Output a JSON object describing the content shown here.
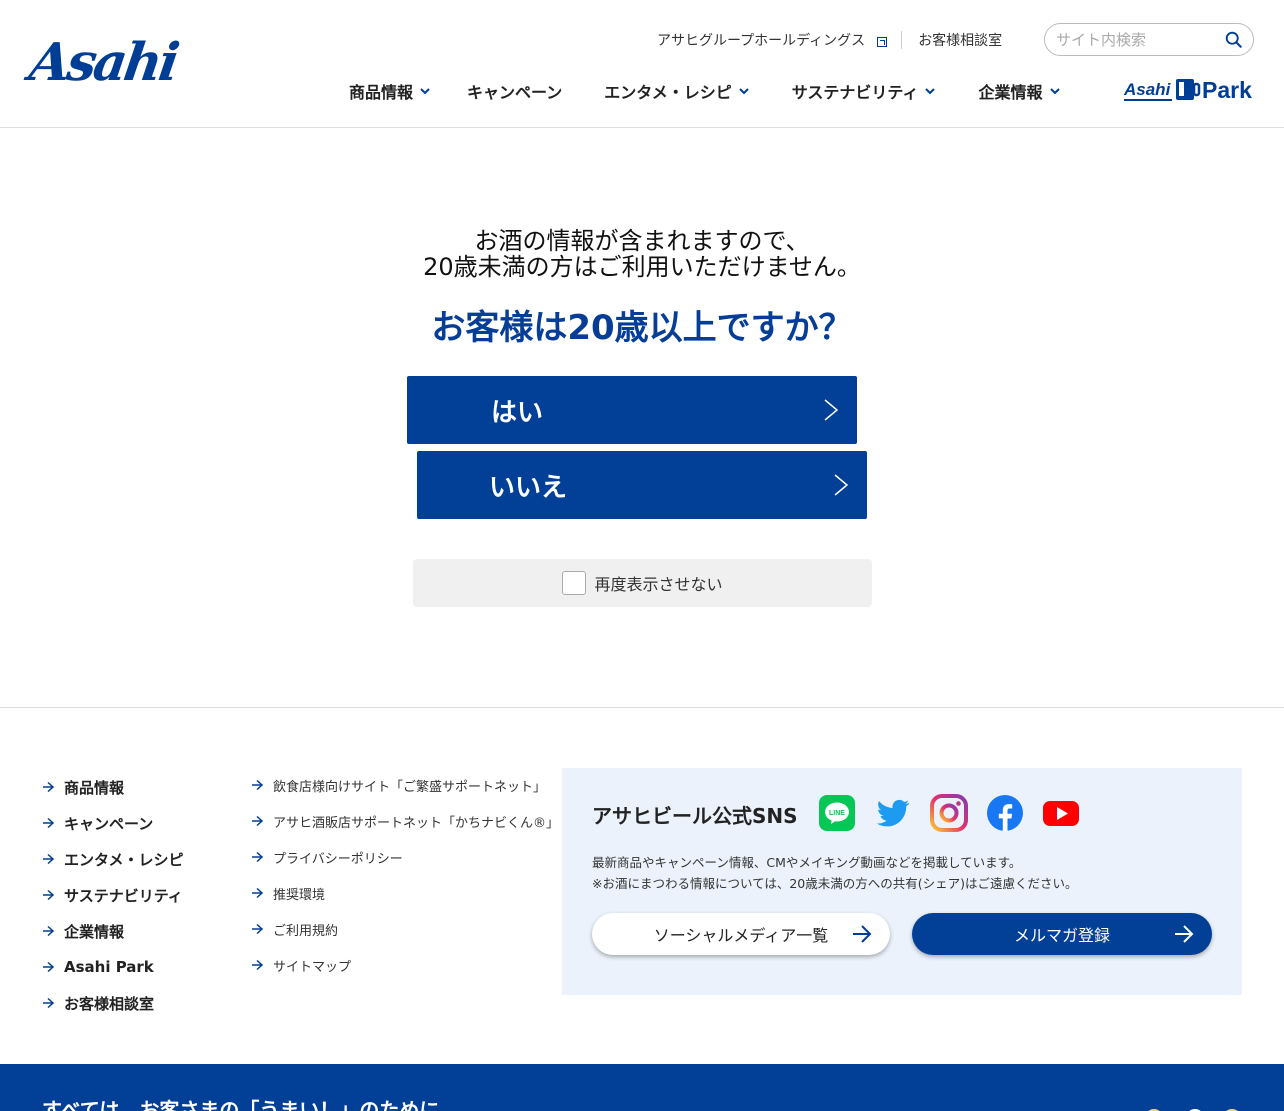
{
  "header": {
    "logo": "Asahi",
    "group_link": "アサヒグループホールディングス",
    "consult_link": "お客様相談室",
    "search_placeholder": "サイト内検索",
    "nav": [
      {
        "label": "商品情報",
        "has_dropdown": true
      },
      {
        "label": "キャンペーン",
        "has_dropdown": false
      },
      {
        "label": "エンタメ・レシピ",
        "has_dropdown": true
      },
      {
        "label": "サステナビリティ",
        "has_dropdown": true
      },
      {
        "label": "企業情報",
        "has_dropdown": true
      }
    ],
    "park_logo": "Asahi Park"
  },
  "age_gate": {
    "message_line1": "お酒の情報が含まれますので、",
    "message_line2": "20歳未満の方はご利用いただけません。",
    "question": "お客様は20歳以上ですか？",
    "yes_label": "はい",
    "no_label": "いいえ",
    "dont_show_label": "再度表示させない",
    "dont_show_checked": false
  },
  "footer": {
    "col1": [
      "商品情報",
      "キャンペーン",
      "エンタメ・レシピ",
      "サステナビリティ",
      "企業情報",
      "Asahi Park",
      "お客様相談室"
    ],
    "col2": [
      "飲食店様向けサイト「ご繁盛サポートネット」",
      "アサヒ酒販店サポートネット「かちナビくん®」",
      "プライバシーポリシー",
      "推奨環境",
      "ご利用規約",
      "サイトマップ"
    ],
    "sns": {
      "title": "アサヒビール公式SNS",
      "icons": [
        "line-icon",
        "twitter-icon",
        "instagram-icon",
        "facebook-icon",
        "youtube-icon"
      ],
      "desc_line1": "最新商品やキャンペーン情報、CMやメイキング動画などを掲載しています。",
      "desc_line2": "※お酒にまつわる情報については、20歳未満の方への共有(シェア)はご遠慮ください。",
      "social_list_button": "ソーシャルメディア一覧",
      "newsletter_button": "メルマガ登録"
    },
    "tagline": "すべては、お客さまの「うまい！」のために"
  },
  "colors": {
    "brand_blue": "#023f97",
    "sns_bg": "#ebf2fb",
    "line_green": "#06c755",
    "twitter_blue": "#1d9bf0",
    "facebook_blue": "#1877f2",
    "youtube_red": "#ff0000"
  }
}
